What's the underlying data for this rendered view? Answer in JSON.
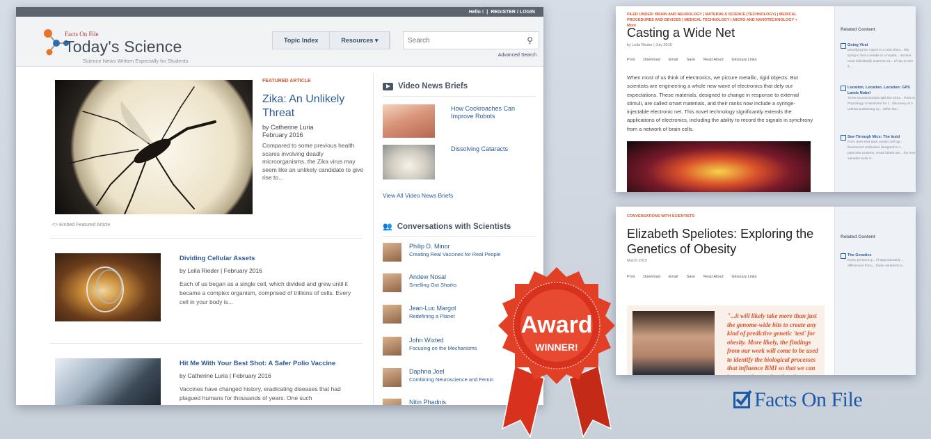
{
  "main": {
    "topbar": {
      "greeting": "Hello !",
      "divider": "|",
      "login": "REGISTER / LOGIN"
    },
    "brand": {
      "small": "Facts On File",
      "title": "Today's Science",
      "tagline": "Science News Written Especially for Students"
    },
    "nav": {
      "topic_index": "Topic Index",
      "resources": "Resources ▾"
    },
    "search": {
      "placeholder": "Search",
      "advanced": "Advanced Search"
    },
    "featured": {
      "label": "FEATURED ARTICLE",
      "title": "Zika: An Unlikely Threat",
      "author": "by Catherine Luria",
      "date": "February 2016",
      "summary": "Compared to some previous health scares involving deadly microorganisms, the Zika virus may seem like an unlikely candidate to give rise to...",
      "embed": "<> Embed Featured Article"
    },
    "articles": [
      {
        "title": "Dividing Cellular Assets",
        "meta": "by Leila Rieder | February 2016",
        "summary": "Each of us began as a single cell, which divided and grew until it became a complex organism, comprised of trillions of cells. Every cell in your body is..."
      },
      {
        "title": "Hit Me With Your Best Shot: A Safer Polio Vaccine",
        "meta": "by Catherine Luria | February 2016",
        "summary": "Vaccines have changed history, eradicating diseases that had plagued humans for thousands of years. One such"
      }
    ],
    "video": {
      "heading": "Video News Briefs",
      "items": [
        {
          "title": "How Cockroaches Can Improve Robots"
        },
        {
          "title": "Dissolving Cataracts"
        }
      ],
      "view_all": "View All Video News Briefs"
    },
    "conversations": {
      "heading": "Conversations with Scientists",
      "items": [
        {
          "name": "Philip D. Minor",
          "desc": "Creating Real Vaccines for Real People"
        },
        {
          "name": "Andew Nosal",
          "desc": "Smelling Out Sharks"
        },
        {
          "name": "Jean-Luc Margot",
          "desc": "Redefining a Planet"
        },
        {
          "name": "John Wixted",
          "desc": "Focusing on the Mechanisms"
        },
        {
          "name": "Daphna Joel",
          "desc": "Combining Neuroscience and Femin"
        },
        {
          "name": "Nitin Phadnis",
          "desc": ""
        }
      ]
    }
  },
  "card1": {
    "filed": "FILED UNDER: BRAIN AND NEUROLOGY | MATERIALS SCIENCE (TECHNOLOGY) | MEDICAL PROCEDURES AND DEVICES | MEDICAL TECHNOLOGY | MICRO AND NANOTECHNOLOGY + More",
    "title": "Casting a Wide Net",
    "meta": "by Leila Rieder | July 2015",
    "tools": [
      "Print",
      "Download",
      "Email",
      "Save",
      "Read Aloud",
      "Glossary Links"
    ],
    "body": "When most of us think of electronics, we picture metallic, rigid objects. But scientists are engineering a whole new wave of electronics that defy our expectations. These materials, designed to change in response to external stimuli, are called smart materials, and their ranks now include a syringe-injectable electronic net. This novel technology significantly extends the applications of electronics, including the ability to record the signals in synchrony from a network of brain cells.",
    "related_heading": "Related Content",
    "related": [
      {
        "title": "Going Viral",
        "snippet": "Identifying the culprit in a viral infect... like trying to find a needle in a haysta... doctors must individually examine ea... of hay to see if..."
      },
      {
        "title": "Location, Location, Location: GPS Lands Nobel",
        "snippet": "Three neuroscientists split the 2014... Prize in Physiology or Medicine for t... discovery of a cellular positioning sy... within the..."
      },
      {
        "title": "See-Through Mice: The Insid",
        "snippet": "From dyes that stain certain cell typ... fluorescent antibodies designed to t... particular proteins, visual labels are... the most valuable tools in..."
      }
    ]
  },
  "card2": {
    "label": "CONVERSATIONS WITH SCIENTISTS",
    "title": "Elizabeth Speliotes: Exploring the Genetics of Obesity",
    "date": "March 2015",
    "tools": [
      "Print",
      "Download",
      "Email",
      "Save",
      "Read Aloud",
      "Glossary Links"
    ],
    "quote": "\"...it will likely take more than just the genome-wide hits to create any kind of predictive genetic 'test' for obesity. More likely, the findings from our work will come to be used to identify the biological processes that influence BMI so that we can better understand and curb",
    "related_heading": "Related Content",
    "related": [
      {
        "title": "The Genetics",
        "snippet": "Every person's g... of approximately ... differences throu... these variations a..."
      }
    ]
  },
  "award": {
    "line1": "Award",
    "line2": "WINNER!"
  },
  "footer_brand": "Facts On File",
  "colors": {
    "accent": "#d9542b",
    "link": "#2b5a94",
    "brand_blue": "#1d5aa5",
    "award_red": "#d8321e"
  }
}
